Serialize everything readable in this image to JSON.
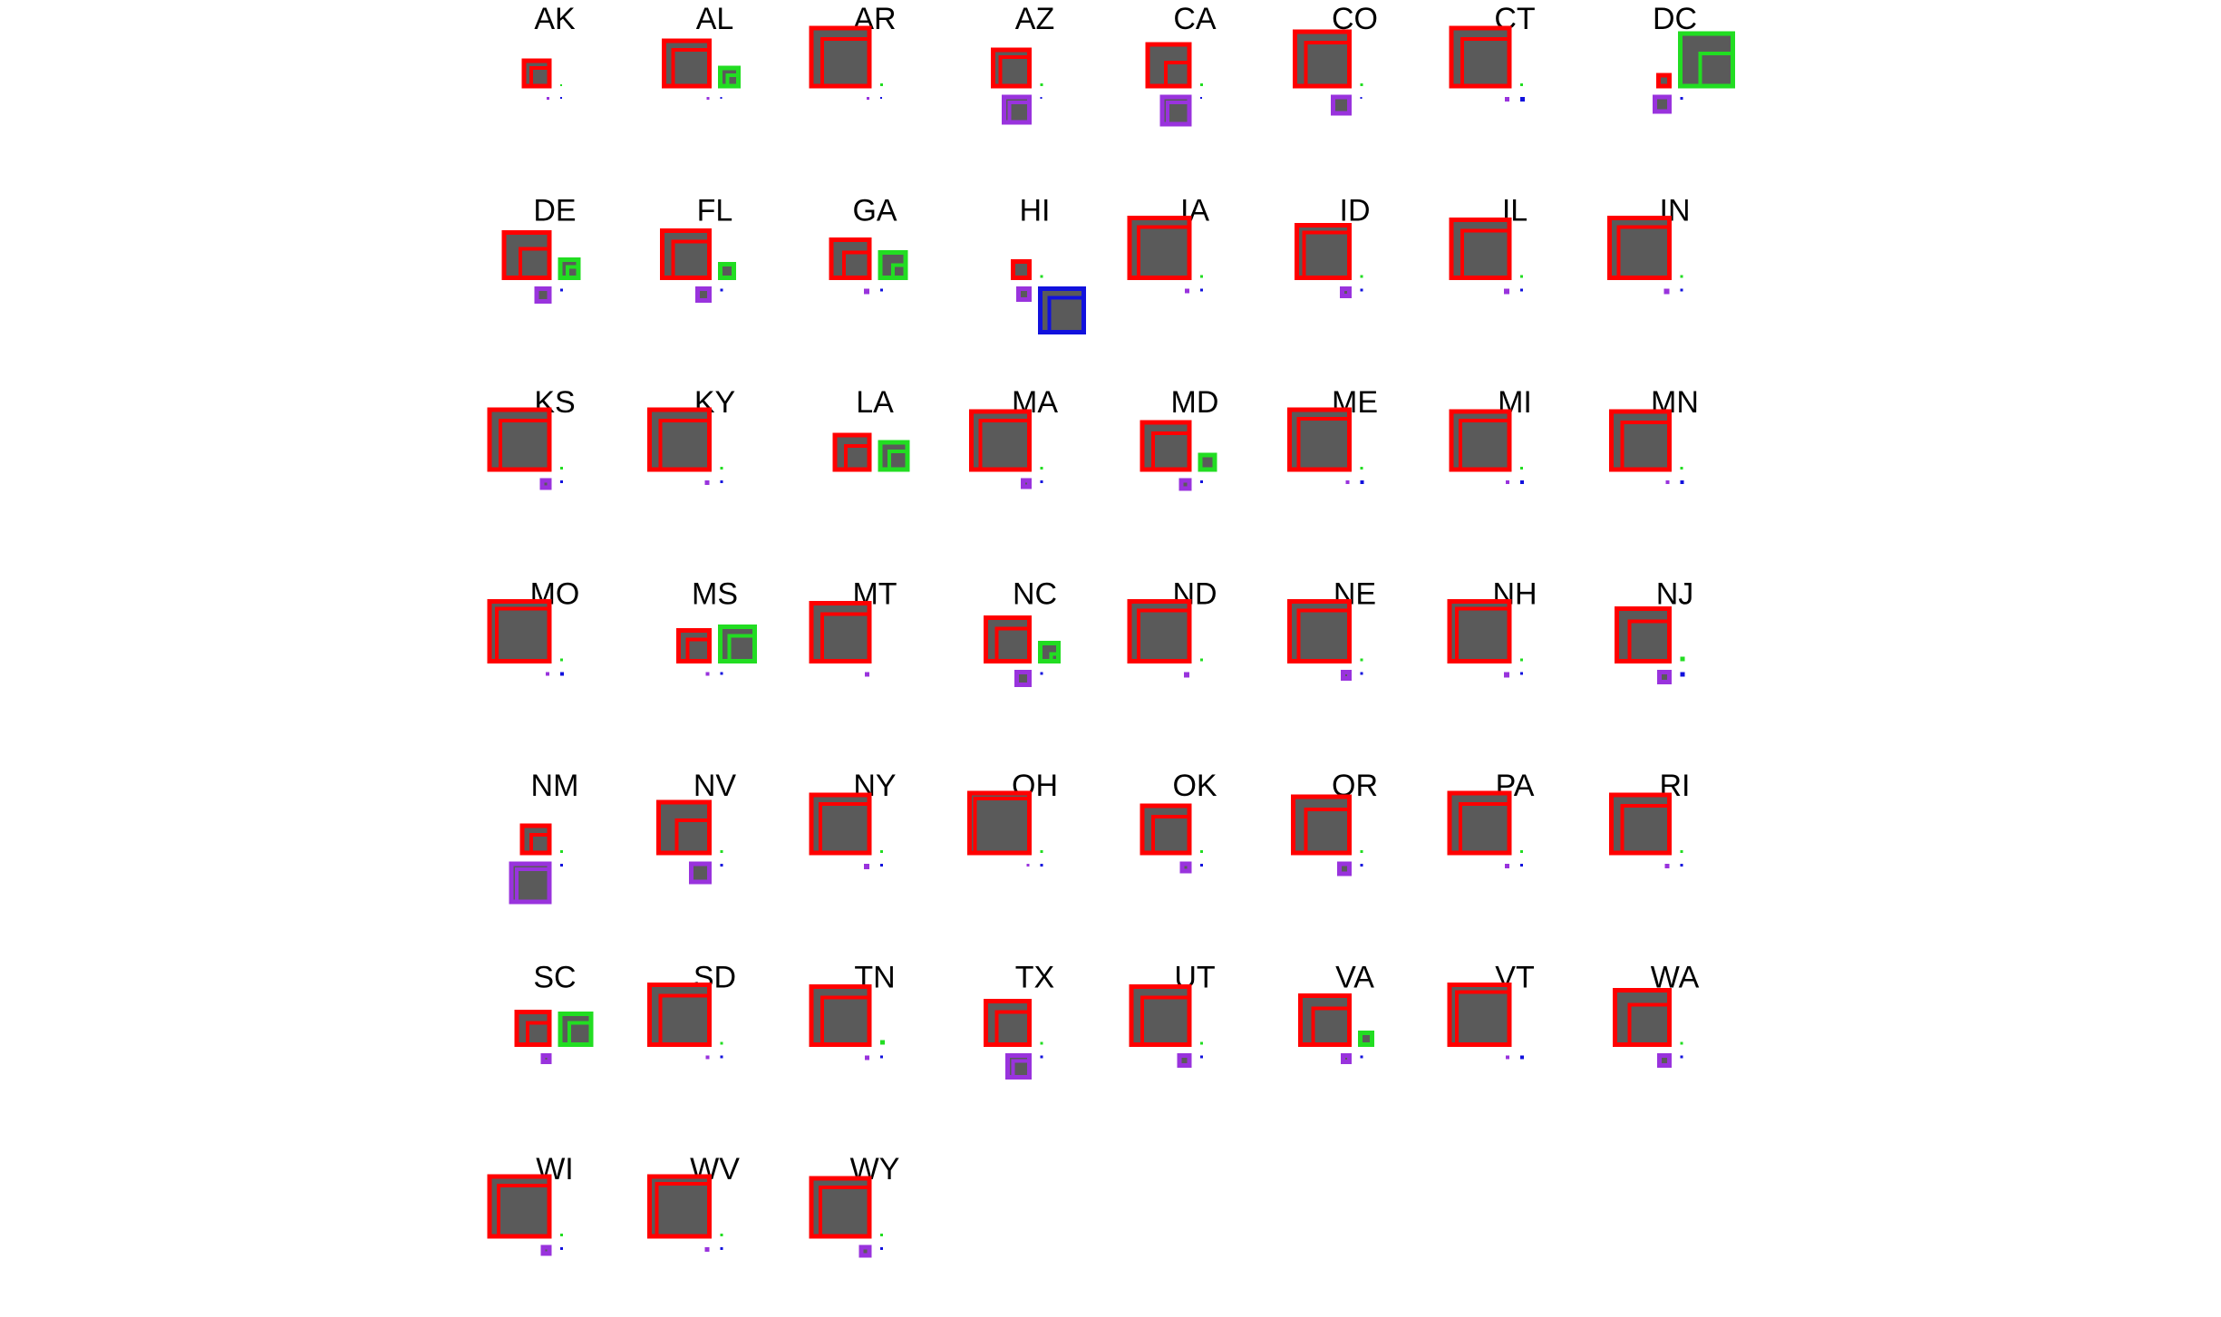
{
  "chart_data": {
    "type": "small-multiples-square-glyphs",
    "title": "",
    "xlabel": "",
    "ylabel": "",
    "legend": "none",
    "grid": false,
    "categories": [
      "red",
      "green",
      "purple",
      "blue"
    ],
    "colors": {
      "red": "#ff0000",
      "green": "#22dd22",
      "purple": "#9933dd",
      "blue": "#1111dd",
      "fill": "#5a5a5a",
      "text": "#000000"
    },
    "value_note": "values are approximate square side lengths read off the glyphs; inner = inner outlined square, 0 = none",
    "states": [
      {
        "name": "AK",
        "red": 28,
        "red_inner": 20,
        "green": 2,
        "green_inner": 0,
        "purple": 3,
        "purple_inner": 0,
        "blue": 2,
        "blue_inner": 0
      },
      {
        "name": "AL",
        "red": 50,
        "red_inner": 40,
        "green": 20,
        "green_inner": 12,
        "purple": 3,
        "purple_inner": 0,
        "blue": 2,
        "blue_inner": 0
      },
      {
        "name": "AR",
        "red": 64,
        "red_inner": 52,
        "green": 3,
        "green_inner": 0,
        "purple": 3,
        "purple_inner": 0,
        "blue": 2,
        "blue_inner": 0
      },
      {
        "name": "AZ",
        "red": 40,
        "red_inner": 32,
        "green": 3,
        "green_inner": 0,
        "purple": 28,
        "purple_inner": 22,
        "blue": 2,
        "blue_inner": 0
      },
      {
        "name": "CA",
        "red": 46,
        "red_inner": 26,
        "green": 3,
        "green_inner": 0,
        "purple": 30,
        "purple_inner": 24,
        "blue": 2,
        "blue_inner": 0
      },
      {
        "name": "CO",
        "red": 60,
        "red_inner": 48,
        "green": 3,
        "green_inner": 0,
        "purple": 18,
        "purple_inner": 0,
        "blue": 2,
        "blue_inner": 0
      },
      {
        "name": "CT",
        "red": 64,
        "red_inner": 52,
        "green": 3,
        "green_inner": 0,
        "purple": 5,
        "purple_inner": 0,
        "blue": 5,
        "blue_inner": 0
      },
      {
        "name": "DC",
        "red": 12,
        "red_inner": 0,
        "green": 58,
        "green_inner": 36,
        "purple": 16,
        "purple_inner": 0,
        "blue": 3,
        "blue_inner": 0
      },
      {
        "name": "DE",
        "red": 50,
        "red_inner": 32,
        "green": 20,
        "green_inner": 12,
        "purple": 14,
        "purple_inner": 0,
        "blue": 3,
        "blue_inner": 0
      },
      {
        "name": "FL",
        "red": 52,
        "red_inner": 40,
        "green": 15,
        "green_inner": 4,
        "purple": 13,
        "purple_inner": 0,
        "blue": 3,
        "blue_inner": 0
      },
      {
        "name": "GA",
        "red": 42,
        "red_inner": 28,
        "green": 28,
        "green_inner": 14,
        "purple": 6,
        "purple_inner": 0,
        "blue": 3,
        "blue_inner": 0
      },
      {
        "name": "HI",
        "red": 18,
        "red_inner": 0,
        "green": 3,
        "green_inner": 0,
        "purple": 12,
        "purple_inner": 0,
        "blue": 48,
        "blue_inner": 38
      },
      {
        "name": "IA",
        "red": 66,
        "red_inner": 56,
        "green": 3,
        "green_inner": 0,
        "purple": 5,
        "purple_inner": 0,
        "blue": 3,
        "blue_inner": 0
      },
      {
        "name": "ID",
        "red": 58,
        "red_inner": 50,
        "green": 3,
        "green_inner": 0,
        "purple": 8,
        "purple_inner": 0,
        "blue": 3,
        "blue_inner": 0
      },
      {
        "name": "IL",
        "red": 64,
        "red_inner": 52,
        "green": 3,
        "green_inner": 0,
        "purple": 6,
        "purple_inner": 0,
        "blue": 3,
        "blue_inner": 0
      },
      {
        "name": "IN",
        "red": 66,
        "red_inner": 56,
        "green": 3,
        "green_inner": 0,
        "purple": 6,
        "purple_inner": 0,
        "blue": 3,
        "blue_inner": 0
      },
      {
        "name": "KS",
        "red": 66,
        "red_inner": 54,
        "green": 3,
        "green_inner": 0,
        "purple": 8,
        "purple_inner": 0,
        "blue": 3,
        "blue_inner": 0
      },
      {
        "name": "KY",
        "red": 66,
        "red_inner": 54,
        "green": 3,
        "green_inner": 0,
        "purple": 5,
        "purple_inner": 0,
        "blue": 3,
        "blue_inner": 0
      },
      {
        "name": "LA",
        "red": 38,
        "red_inner": 26,
        "green": 30,
        "green_inner": 20,
        "purple": 0,
        "purple_inner": 0,
        "blue": 0,
        "blue_inner": 0
      },
      {
        "name": "MA",
        "red": 64,
        "red_inner": 54,
        "green": 3,
        "green_inner": 0,
        "purple": 7,
        "purple_inner": 0,
        "blue": 3,
        "blue_inner": 0
      },
      {
        "name": "MD",
        "red": 52,
        "red_inner": 40,
        "green": 16,
        "green_inner": 6,
        "purple": 9,
        "purple_inner": 0,
        "blue": 3,
        "blue_inner": 0
      },
      {
        "name": "ME",
        "red": 66,
        "red_inner": 56,
        "green": 3,
        "green_inner": 0,
        "purple": 4,
        "purple_inner": 0,
        "blue": 4,
        "blue_inner": 0
      },
      {
        "name": "MI",
        "red": 64,
        "red_inner": 54,
        "green": 3,
        "green_inner": 0,
        "purple": 4,
        "purple_inner": 0,
        "blue": 4,
        "blue_inner": 0
      },
      {
        "name": "MN",
        "red": 64,
        "red_inner": 52,
        "green": 3,
        "green_inner": 0,
        "purple": 4,
        "purple_inner": 0,
        "blue": 4,
        "blue_inner": 0
      },
      {
        "name": "MO",
        "red": 66,
        "red_inner": 58,
        "green": 3,
        "green_inner": 0,
        "purple": 4,
        "purple_inner": 0,
        "blue": 4,
        "blue_inner": 0
      },
      {
        "name": "MS",
        "red": 34,
        "red_inner": 24,
        "green": 38,
        "green_inner": 28,
        "purple": 4,
        "purple_inner": 0,
        "blue": 3,
        "blue_inner": 0
      },
      {
        "name": "MT",
        "red": 64,
        "red_inner": 52,
        "green": 0,
        "green_inner": 0,
        "purple": 5,
        "purple_inner": 0,
        "blue": 0,
        "blue_inner": 0
      },
      {
        "name": "NC",
        "red": 48,
        "red_inner": 36,
        "green": 20,
        "green_inner": 8,
        "purple": 14,
        "purple_inner": 0,
        "blue": 3,
        "blue_inner": 0
      },
      {
        "name": "ND",
        "red": 66,
        "red_inner": 56,
        "green": 3,
        "green_inner": 0,
        "purple": 6,
        "purple_inner": 0,
        "blue": 0,
        "blue_inner": 0
      },
      {
        "name": "NE",
        "red": 66,
        "red_inner": 56,
        "green": 3,
        "green_inner": 0,
        "purple": 7,
        "purple_inner": 0,
        "blue": 3,
        "blue_inner": 0
      },
      {
        "name": "NH",
        "red": 66,
        "red_inner": 58,
        "green": 3,
        "green_inner": 0,
        "purple": 6,
        "purple_inner": 0,
        "blue": 3,
        "blue_inner": 0
      },
      {
        "name": "NJ",
        "red": 58,
        "red_inner": 44,
        "green": 5,
        "green_inner": 0,
        "purple": 11,
        "purple_inner": 0,
        "blue": 5,
        "blue_inner": 0
      },
      {
        "name": "NM",
        "red": 30,
        "red_inner": 20,
        "green": 3,
        "green_inner": 0,
        "purple": 42,
        "purple_inner": 36,
        "blue": 3,
        "blue_inner": 0
      },
      {
        "name": "NV",
        "red": 56,
        "red_inner": 36,
        "green": 3,
        "green_inner": 0,
        "purple": 20,
        "purple_inner": 0,
        "blue": 3,
        "blue_inner": 0
      },
      {
        "name": "NY",
        "red": 64,
        "red_inner": 54,
        "green": 3,
        "green_inner": 0,
        "purple": 6,
        "purple_inner": 0,
        "blue": 3,
        "blue_inner": 0
      },
      {
        "name": "OH",
        "red": 66,
        "red_inner": 60,
        "green": 3,
        "green_inner": 0,
        "purple": 3,
        "purple_inner": 0,
        "blue": 3,
        "blue_inner": 0
      },
      {
        "name": "OK",
        "red": 52,
        "red_inner": 40,
        "green": 3,
        "green_inner": 0,
        "purple": 8,
        "purple_inner": 0,
        "blue": 3,
        "blue_inner": 0
      },
      {
        "name": "OR",
        "red": 62,
        "red_inner": 48,
        "green": 3,
        "green_inner": 0,
        "purple": 11,
        "purple_inner": 0,
        "blue": 3,
        "blue_inner": 0
      },
      {
        "name": "PA",
        "red": 66,
        "red_inner": 54,
        "green": 3,
        "green_inner": 0,
        "purple": 5,
        "purple_inner": 0,
        "blue": 3,
        "blue_inner": 0
      },
      {
        "name": "RI",
        "red": 64,
        "red_inner": 52,
        "green": 3,
        "green_inner": 0,
        "purple": 5,
        "purple_inner": 0,
        "blue": 3,
        "blue_inner": 0
      },
      {
        "name": "SC",
        "red": 36,
        "red_inner": 24,
        "green": 34,
        "green_inner": 24,
        "purple": 7,
        "purple_inner": 0,
        "blue": 0,
        "blue_inner": 0
      },
      {
        "name": "SD",
        "red": 66,
        "red_inner": 54,
        "green": 3,
        "green_inner": 0,
        "purple": 4,
        "purple_inner": 0,
        "blue": 3,
        "blue_inner": 0
      },
      {
        "name": "TN",
        "red": 64,
        "red_inner": 52,
        "green": 5,
        "green_inner": 0,
        "purple": 5,
        "purple_inner": 0,
        "blue": 3,
        "blue_inner": 0
      },
      {
        "name": "TX",
        "red": 48,
        "red_inner": 36,
        "green": 3,
        "green_inner": 0,
        "purple": 24,
        "purple_inner": 18,
        "blue": 3,
        "blue_inner": 0
      },
      {
        "name": "UT",
        "red": 64,
        "red_inner": 52,
        "green": 3,
        "green_inner": 0,
        "purple": 11,
        "purple_inner": 0,
        "blue": 3,
        "blue_inner": 0
      },
      {
        "name": "VA",
        "red": 54,
        "red_inner": 40,
        "green": 13,
        "green_inner": 3,
        "purple": 7,
        "purple_inner": 0,
        "blue": 3,
        "blue_inner": 0
      },
      {
        "name": "VT",
        "red": 66,
        "red_inner": 58,
        "green": 0,
        "green_inner": 0,
        "purple": 4,
        "purple_inner": 0,
        "blue": 4,
        "blue_inner": 0
      },
      {
        "name": "WA",
        "red": 60,
        "red_inner": 44,
        "green": 3,
        "green_inner": 0,
        "purple": 11,
        "purple_inner": 0,
        "blue": 3,
        "blue_inner": 0
      },
      {
        "name": "WI",
        "red": 66,
        "red_inner": 56,
        "green": 3,
        "green_inner": 0,
        "purple": 7,
        "purple_inner": 0,
        "blue": 3,
        "blue_inner": 0
      },
      {
        "name": "WV",
        "red": 66,
        "red_inner": 58,
        "green": 3,
        "green_inner": 0,
        "purple": 5,
        "purple_inner": 0,
        "blue": 3,
        "blue_inner": 0
      },
      {
        "name": "WY",
        "red": 64,
        "red_inner": 54,
        "green": 3,
        "green_inner": 0,
        "purple": 9,
        "purple_inner": 0,
        "blue": 3,
        "blue_inner": 0
      }
    ]
  }
}
